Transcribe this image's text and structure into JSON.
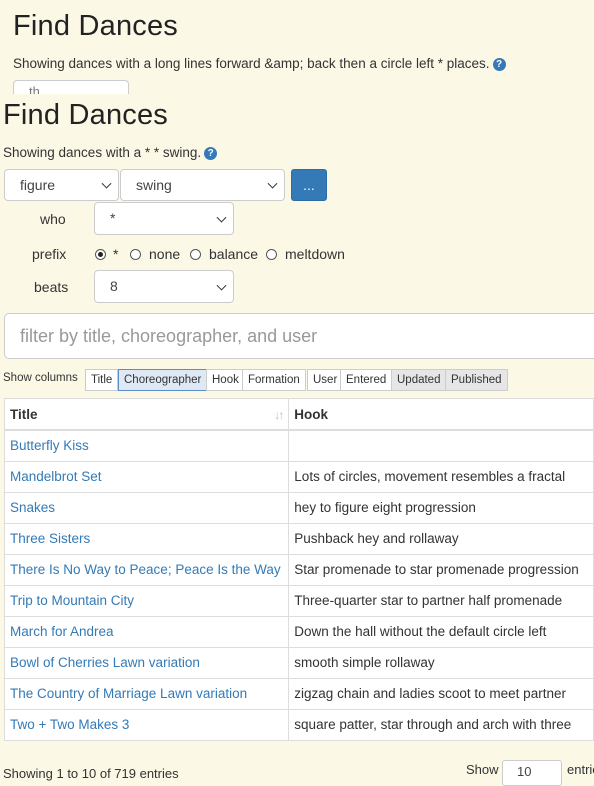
{
  "ghost": {
    "title": "Find Dances",
    "subtitle": "Showing dances with a long lines forward &amp; back then a circle left * places.",
    "partial_select_text": "th"
  },
  "main": {
    "title": "Find Dances",
    "subtitle": "Showing dances with a * * swing.",
    "help_glyph": "?"
  },
  "search": {
    "type_select": "figure",
    "figure_select": "swing",
    "more_button": "...",
    "who_label": "who",
    "who_value": "*",
    "prefix_label": "prefix",
    "prefix_options": [
      {
        "label": "*",
        "checked": true
      },
      {
        "label": "none",
        "checked": false
      },
      {
        "label": "balance",
        "checked": false
      },
      {
        "label": "meltdown",
        "checked": false
      }
    ],
    "beats_label": "beats",
    "beats_value": "8",
    "filter_placeholder": "filter by title, choreographer, and user"
  },
  "columns": {
    "label": "Show columns",
    "buttons": [
      {
        "label": "Title",
        "state": "off"
      },
      {
        "label": "Choreographer",
        "state": "focused"
      },
      {
        "label": "Hook",
        "state": "off"
      },
      {
        "label": "Formation",
        "state": "off"
      },
      {
        "label": "User",
        "state": "off"
      },
      {
        "label": "Entered",
        "state": "off"
      },
      {
        "label": "Updated",
        "state": "active"
      },
      {
        "label": "Published",
        "state": "active"
      }
    ]
  },
  "table": {
    "headers": [
      "Title",
      "Hook"
    ],
    "rows": [
      {
        "title": "Butterfly Kiss",
        "hook": ""
      },
      {
        "title": "Mandelbrot Set",
        "hook": "Lots of circles, movement resembles a fractal"
      },
      {
        "title": "Snakes",
        "hook": "hey to figure eight progression"
      },
      {
        "title": "Three Sisters",
        "hook": "Pushback hey and rollaway"
      },
      {
        "title": "There Is No Way to Peace; Peace Is the Way",
        "hook": "Star promenade to star promenade progression"
      },
      {
        "title": "Trip to Mountain City",
        "hook": "Three-quarter star to partner half promenade"
      },
      {
        "title": "March for Andrea",
        "hook": "Down the hall without the default circle left"
      },
      {
        "title": "Bowl of Cherries Lawn variation",
        "hook": "smooth simple rollaway"
      },
      {
        "title": "The Country of Marriage Lawn variation",
        "hook": "zigzag chain and ladies scoot to meet partner"
      },
      {
        "title": "Two + Two Makes 3",
        "hook": "square patter, star through and arch with three"
      }
    ]
  },
  "footer": {
    "info": "Showing 1 to 10 of 719 entries",
    "show_label": "Show",
    "page_size": "10",
    "entries_label": "entries"
  },
  "colors": {
    "background": "#fbf8e6",
    "link": "#337ab7",
    "primary_button": "#337ab7"
  }
}
